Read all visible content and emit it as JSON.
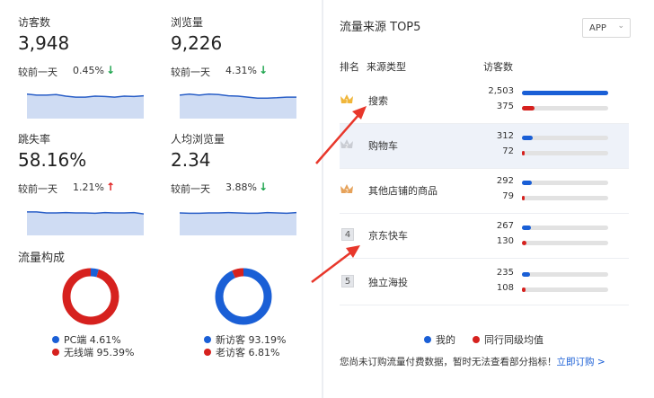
{
  "metrics": [
    {
      "label": "访客数",
      "value": "3,948",
      "compare_label": "较前一天",
      "compare_value": "0.45%",
      "trend": "down",
      "trend_glyph": "↓",
      "spark": [
        0.6,
        0.55,
        0.55,
        0.58,
        0.5,
        0.45,
        0.45,
        0.5,
        0.48,
        0.45,
        0.5,
        0.48,
        0.52
      ]
    },
    {
      "label": "浏览量",
      "value": "9,226",
      "compare_label": "较前一天",
      "compare_value": "4.31%",
      "trend": "down",
      "trend_glyph": "↓",
      "spark": [
        0.55,
        0.6,
        0.55,
        0.6,
        0.58,
        0.52,
        0.5,
        0.45,
        0.4,
        0.4,
        0.42,
        0.45,
        0.45
      ]
    },
    {
      "label": "跳失率",
      "value": "58.16%",
      "compare_label": "较前一天",
      "compare_value": "1.21%",
      "trend": "up",
      "trend_glyph": "↑",
      "spark": [
        0.55,
        0.55,
        0.5,
        0.5,
        0.52,
        0.5,
        0.5,
        0.48,
        0.52,
        0.5,
        0.5,
        0.52,
        0.45
      ]
    },
    {
      "label": "人均浏览量",
      "value": "2.34",
      "compare_label": "较前一天",
      "compare_value": "3.88%",
      "trend": "down",
      "trend_glyph": "↓",
      "spark": [
        0.5,
        0.48,
        0.48,
        0.5,
        0.5,
        0.52,
        0.5,
        0.48,
        0.48,
        0.52,
        0.5,
        0.48,
        0.52
      ]
    }
  ],
  "composition": {
    "title": "流量构成",
    "device": {
      "segments": [
        {
          "name": "PC端",
          "percent": 4.61,
          "text": "PC端 4.61%",
          "color": "#1a5fd6"
        },
        {
          "name": "无线端",
          "percent": 95.39,
          "text": "无线端 95.39%",
          "color": "#d6211e"
        }
      ]
    },
    "visitor": {
      "segments": [
        {
          "name": "新访客",
          "percent": 93.19,
          "text": "新访客 93.19%",
          "color": "#1a5fd6"
        },
        {
          "name": "老访客",
          "percent": 6.81,
          "text": "老访客 6.81%",
          "color": "#d6211e"
        }
      ]
    }
  },
  "sources": {
    "title": "流量来源 TOP5",
    "platform_select": "APP",
    "headers": {
      "rank": "排名",
      "type": "来源类型",
      "visitors": "访客数"
    },
    "max_value": 2503,
    "rows": [
      {
        "rank": "1",
        "medal": "gold",
        "name": "搜索",
        "mine": 2503,
        "mine_text": "2,503",
        "peer": 375,
        "peer_text": "375"
      },
      {
        "rank": "2",
        "medal": "silver",
        "name": "购物车",
        "mine": 312,
        "mine_text": "312",
        "peer": 72,
        "peer_text": "72"
      },
      {
        "rank": "3",
        "medal": "bronze",
        "name": "其他店铺的商品",
        "mine": 292,
        "mine_text": "292",
        "peer": 79,
        "peer_text": "79"
      },
      {
        "rank": "4",
        "medal": "",
        "name": "京东快车",
        "mine": 267,
        "mine_text": "267",
        "peer": 130,
        "peer_text": "130"
      },
      {
        "rank": "5",
        "medal": "",
        "name": "独立海投",
        "mine": 235,
        "mine_text": "235",
        "peer": 108,
        "peer_text": "108"
      }
    ],
    "legend": {
      "mine": "我的",
      "peer": "同行同级均值"
    },
    "notice": "您尚未订购流量付费数据，暂时无法查看部分指标！",
    "notice_link": "立即订购 >"
  },
  "colors": {
    "blue": "#1a5fd6",
    "red": "#d6211e",
    "spark_line": "#2a5fc7",
    "spark_fill": "#cfdcf3",
    "arrow": "#e8372b"
  }
}
